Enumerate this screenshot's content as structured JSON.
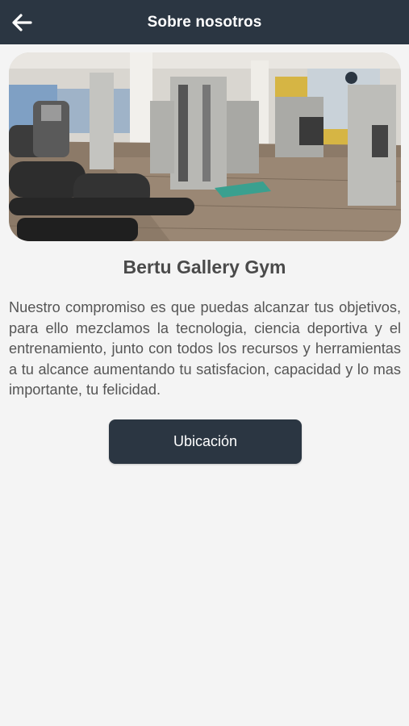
{
  "header": {
    "title": "Sobre nosotros",
    "back_icon": "arrow-left-icon"
  },
  "gallery": {
    "image_description_icon": "gym-photo",
    "active_slide_indicator": true
  },
  "content": {
    "name": "Bertu Gallery Gym",
    "description": "Nuestro compromiso es que puedas alcanzar tus objetivos, para ello mezclamos la tecnologia, ciencia deportiva y el entrenamiento, junto con todos los recursos y herramientas a tu alcance aumentando tu satisfacion, capacidad y lo mas importante, tu felicidad."
  },
  "actions": {
    "location_label": "Ubicación"
  },
  "colors": {
    "primary": "#2b3642",
    "background": "#f4f4f4",
    "text": "#555555"
  }
}
